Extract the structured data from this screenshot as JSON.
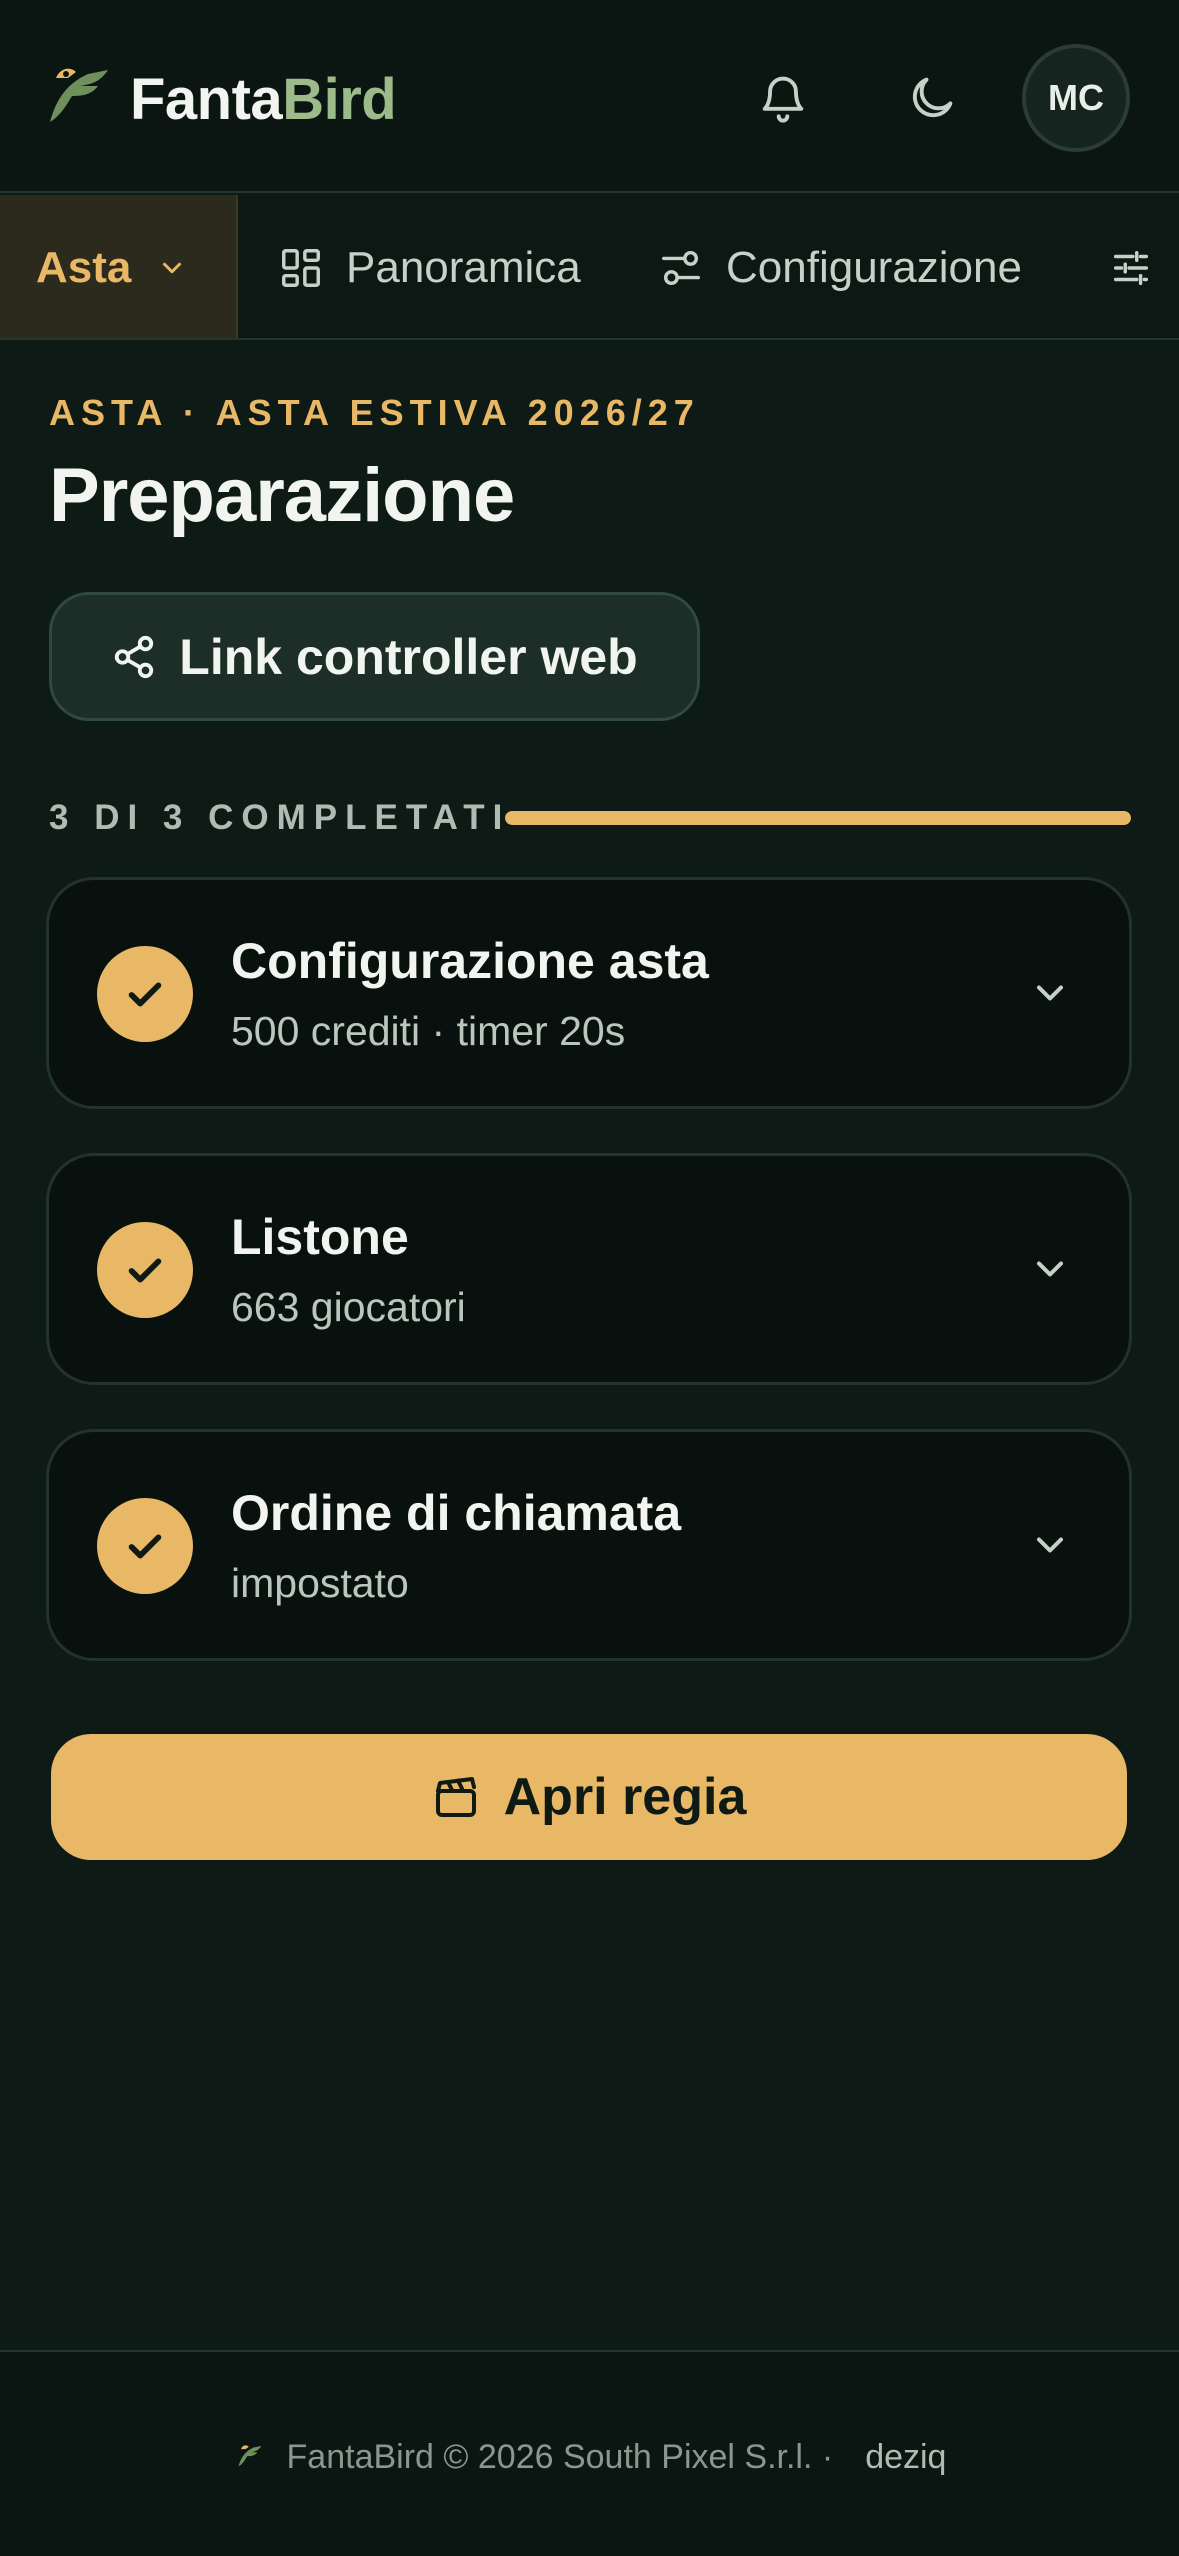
{
  "header": {
    "brand_part1": "Fanta",
    "brand_part2": "Bird",
    "avatar_initials": "MC"
  },
  "nav": {
    "active_label": "Asta",
    "items": [
      {
        "label": "Panoramica",
        "icon": "grid-icon"
      },
      {
        "label": "Configurazione",
        "icon": "sliders-icon"
      }
    ],
    "overflow_icon": "filters-icon"
  },
  "page": {
    "eyebrow": "ASTA · ASTA ESTIVA 2026/27",
    "title": "Preparazione",
    "link_button": "Link controller web"
  },
  "progress": {
    "label": "3 DI 3 COMPLETATI",
    "completed": 3,
    "total": 3
  },
  "steps": [
    {
      "title": "Configurazione asta",
      "subtitle": "500 crediti · timer 20s",
      "done": true
    },
    {
      "title": "Listone",
      "subtitle": "663 giocatori",
      "done": true
    },
    {
      "title": "Ordine di chiamata",
      "subtitle": "impostato",
      "done": true
    }
  ],
  "cta": {
    "label": "Apri regia",
    "icon": "clapperboard-icon"
  },
  "footer": {
    "text": "FantaBird © 2026 South Pixel S.r.l. ·",
    "link": "deziq"
  },
  "colors": {
    "background": "#0e1a16",
    "accent": "#e9b866",
    "brand_green": "#9dbb8a"
  }
}
